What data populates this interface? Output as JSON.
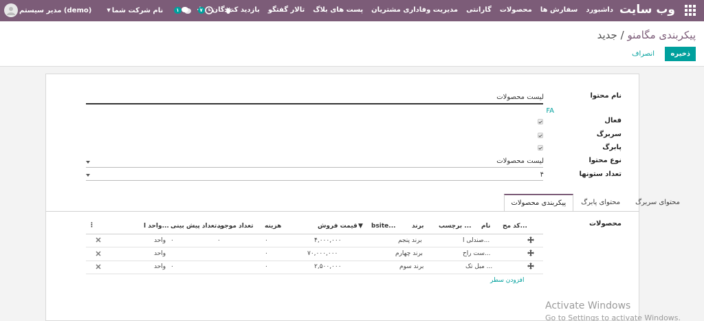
{
  "nav": {
    "brand": "وب سایت",
    "menu": [
      "داشبورد",
      "سفارش ها",
      "محصولات",
      "گارانتی",
      "مدیریت وفاداری مشتریان",
      "پست های بلاگ",
      "تالار گفتگو",
      "بازدید کنندگان"
    ],
    "plus": "+",
    "activities_count": "۷",
    "messages_count": "۱",
    "company": "نام شرکت شما",
    "user": "مدیر سیستم (demo)"
  },
  "breadcrumb": {
    "parent": "پیکربندی مگامنو",
    "separator": "/",
    "current": "جدید"
  },
  "buttons": {
    "save": "ذخیره",
    "discard": "انصراف"
  },
  "form": {
    "content_name_label": "نام محتوا",
    "content_name_value": "لیست محصولات",
    "lang": "FA",
    "active_label": "فعال",
    "header_label": "سربرگ",
    "footer_label": "پابرگ",
    "content_type_label": "نوع محتوا",
    "content_type_value": "لیست محصولات",
    "columns_label": "تعداد ستونها",
    "columns_value": "۴"
  },
  "tabs": [
    "محتوای سربرگ",
    "محتوای پابرگ",
    "پیکربندی محصولات"
  ],
  "products": {
    "label": "محصولات",
    "headers": {
      "code": "کد مح...",
      "name": "نام",
      "tag": "برچسب ...",
      "brand": "برند",
      "website": "bsite...",
      "price": "قیمت فروش",
      "cost": "هزینه",
      "stock": "تعداد موجود",
      "forecast": "تعداد پیش بینی...",
      "uom": "واحد ا..."
    },
    "rows": [
      {
        "name": "صندلی ا...",
        "brand": "برند پنجم",
        "price": "۴,۰۰۰,۰۰۰",
        "cost": "۰",
        "stock": "۰",
        "forecast": "۰",
        "uom": "واحد"
      },
      {
        "name": "ست راح...",
        "brand": "برند چهارم",
        "price": "۷۰,۰۰۰,۰۰۰",
        "cost": "۰",
        "stock": "",
        "forecast": "",
        "uom": "واحد"
      },
      {
        "name": "مبل تک ...",
        "brand": "برند سوم",
        "price": "۲,۵۰۰,۰۰۰",
        "cost": "۰",
        "stock": "",
        "forecast": "۰",
        "uom": "واحد"
      }
    ],
    "add_line": "افزودن سطر"
  },
  "watermark": {
    "line1": "Activate Windows",
    "line2": "Go to Settings to activate Windows."
  }
}
